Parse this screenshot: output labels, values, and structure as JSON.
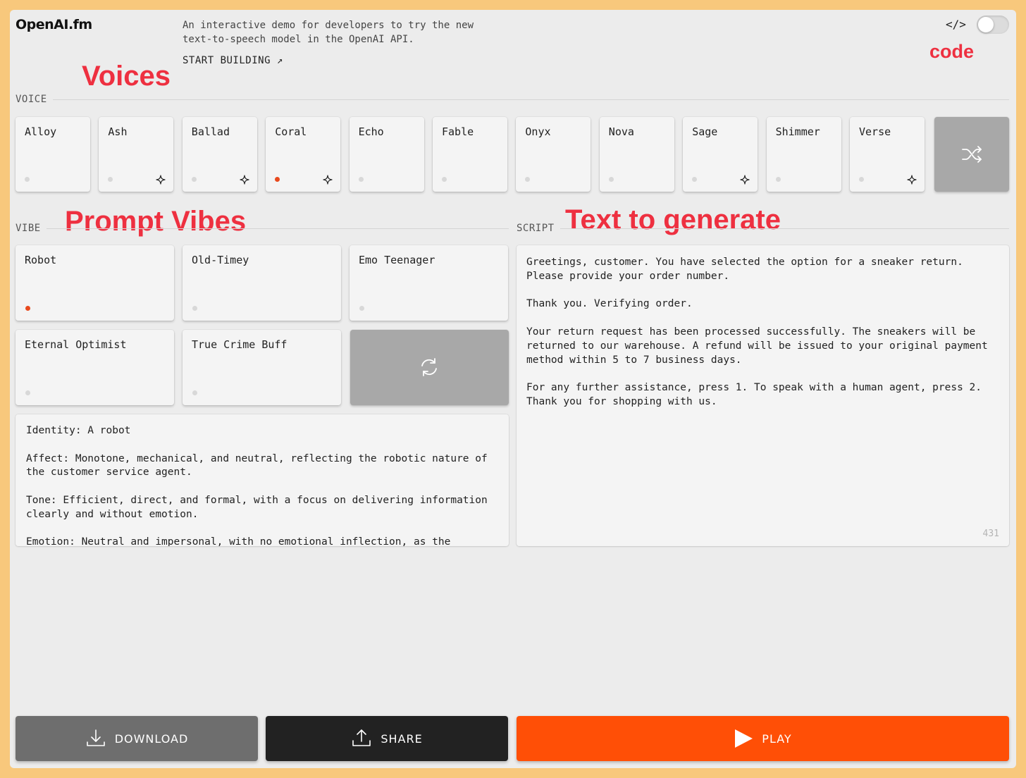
{
  "header": {
    "logo": "OpenAI.fm",
    "intro": "An interactive demo for developers to try the new text-to-speech model in the OpenAI API.",
    "start_link": "START BUILDING",
    "start_link_arrow": "↗",
    "code_icon": "</>",
    "code_toggle_on": false
  },
  "annotations": {
    "voices": "Voices",
    "code": "code",
    "prompt_vibes": "Prompt Vibes",
    "text_to_generate": "Text to generate"
  },
  "voice_section": {
    "label": "VOICE",
    "voices": [
      {
        "name": "Alloy",
        "selected": false,
        "sparkle": false
      },
      {
        "name": "Ash",
        "selected": false,
        "sparkle": true
      },
      {
        "name": "Ballad",
        "selected": false,
        "sparkle": true
      },
      {
        "name": "Coral",
        "selected": true,
        "sparkle": true
      },
      {
        "name": "Echo",
        "selected": false,
        "sparkle": false
      },
      {
        "name": "Fable",
        "selected": false,
        "sparkle": false
      },
      {
        "name": "Onyx",
        "selected": false,
        "sparkle": false
      },
      {
        "name": "Nova",
        "selected": false,
        "sparkle": false
      },
      {
        "name": "Sage",
        "selected": false,
        "sparkle": true
      },
      {
        "name": "Shimmer",
        "selected": false,
        "sparkle": false
      },
      {
        "name": "Verse",
        "selected": false,
        "sparkle": true
      }
    ],
    "shuffle_icon": "shuffle-icon"
  },
  "vibe_section": {
    "label": "VIBE",
    "vibes": [
      {
        "name": "Robot",
        "selected": true
      },
      {
        "name": "Old-Timey",
        "selected": false
      },
      {
        "name": "Emo Teenager",
        "selected": false
      },
      {
        "name": "Eternal Optimist",
        "selected": false
      },
      {
        "name": "True Crime Buff",
        "selected": false
      }
    ],
    "refresh_icon": "refresh-icon",
    "prompt_text": "Identity: A robot\n\nAffect: Monotone, mechanical, and neutral, reflecting the robotic nature of the customer service agent.\n\nTone: Efficient, direct, and formal, with a focus on delivering information clearly and without emotion.\n\nEmotion: Neutral and impersonal, with no emotional inflection, as the"
  },
  "script_section": {
    "label": "SCRIPT",
    "text": "Greetings, customer. You have selected the option for a sneaker return. Please provide your order number.\n\nThank you. Verifying order.\n\nYour return request has been processed successfully. The sneakers will be returned to our warehouse. A refund will be issued to your original payment method within 5 to 7 business days.\n\nFor any further assistance, press 1. To speak with a human agent, press 2. Thank you for shopping with us.",
    "char_count": "431"
  },
  "actions": {
    "download": "DOWNLOAD",
    "share": "SHARE",
    "play": "PLAY"
  },
  "colors": {
    "accent": "#ff4f06",
    "selected_dot": "#e8491d",
    "annotation": "#ee3040",
    "share_bg": "#222222",
    "download_bg": "#6e6e6e"
  }
}
